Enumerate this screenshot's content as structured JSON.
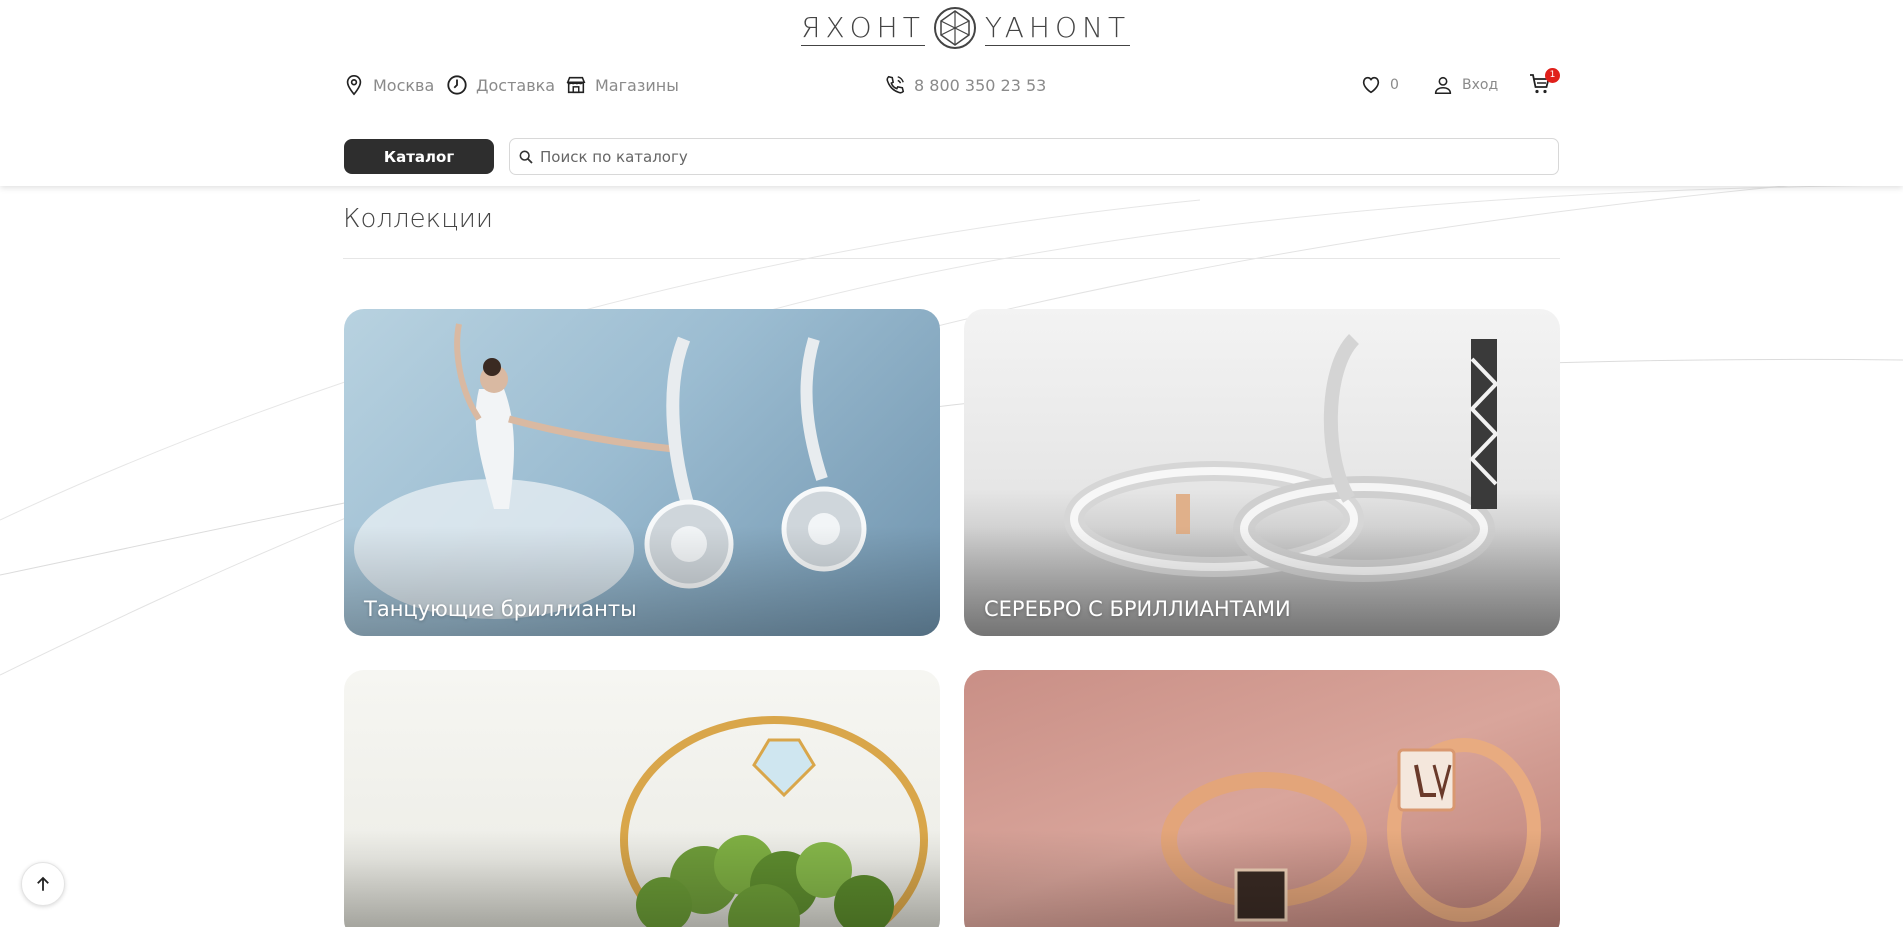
{
  "header": {
    "logo_left": "ЯХОНТ",
    "logo_right": "YAHONT",
    "city": "Москва",
    "delivery": "Доставка",
    "shops": "Магазины",
    "phone": "8 800 350 23 53",
    "favorites_count": "0",
    "login": "Вход",
    "cart_count": "1",
    "catalog_button": "Каталог",
    "search_placeholder": "Поиск по каталогу"
  },
  "main": {
    "title": "Коллекции",
    "collections": [
      {
        "caption": "Танцующие бриллианты"
      },
      {
        "caption": "СЕРЕБРО С БРИЛЛИАНТАМИ"
      },
      {
        "caption": ""
      },
      {
        "caption": ""
      }
    ]
  },
  "icons": {
    "location": "map-pin-icon",
    "delivery": "clock-icon",
    "shops": "store-icon",
    "phone": "phone-icon",
    "favorites": "heart-icon",
    "login": "user-icon",
    "cart": "cart-icon",
    "search": "search-icon",
    "scroll_top": "arrow-up-icon"
  },
  "colors": {
    "catalog_button": "#2e2e2e",
    "cart_badge": "#e0201b",
    "muted_text": "#8a8a8a"
  }
}
